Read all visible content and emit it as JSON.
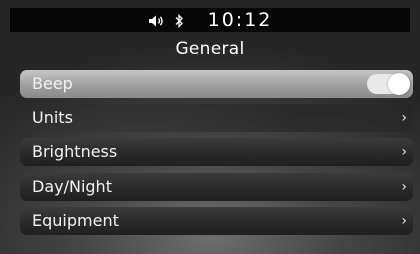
{
  "status": {
    "time": "10:12",
    "icons": [
      "speaker-icon",
      "bluetooth-icon"
    ]
  },
  "page": {
    "title": "General"
  },
  "menu": {
    "items": [
      {
        "label": "Beep",
        "control": "toggle",
        "toggle_on": true,
        "selected": true
      },
      {
        "label": "Units",
        "control": "chevron",
        "chevron": "›"
      },
      {
        "label": "Brightness",
        "control": "chevron",
        "chevron": "›"
      },
      {
        "label": "Day/Night",
        "control": "chevron",
        "chevron": "›"
      },
      {
        "label": "Equipment",
        "control": "chevron",
        "chevron": "›"
      }
    ]
  },
  "colors": {
    "statusbar": "#070707",
    "selected_row": "#a2a2a2",
    "toggle_on": "#e9e9e9"
  }
}
